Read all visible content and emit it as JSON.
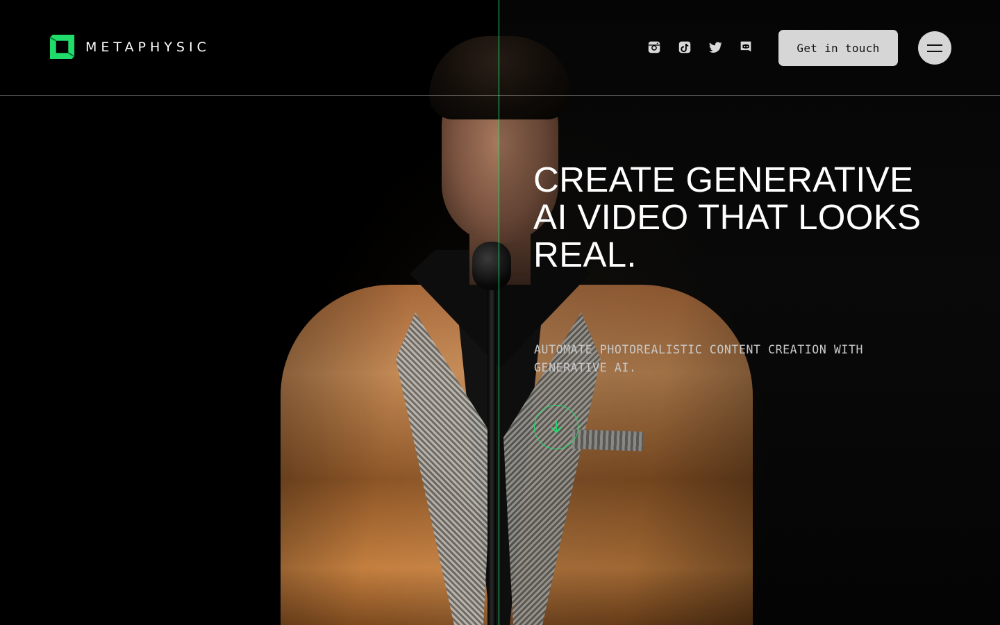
{
  "brand": {
    "name": "METAPHYSIC",
    "accent": "#1fdc6b"
  },
  "header": {
    "socials": [
      {
        "name": "instagram-icon"
      },
      {
        "name": "tiktok-icon"
      },
      {
        "name": "twitter-icon"
      },
      {
        "name": "discord-icon"
      }
    ],
    "cta_label": "Get in touch",
    "menu_icon": "hamburger-icon"
  },
  "hero": {
    "headline": "CREATE GENERATIVE AI VIDEO THAT LOOKS REAL.",
    "subline": "AUTOMATE PHOTOREALISTIC CONTENT CREATION WITH GENERATIVE AI.",
    "scroll_icon": "arrow-down-icon"
  }
}
